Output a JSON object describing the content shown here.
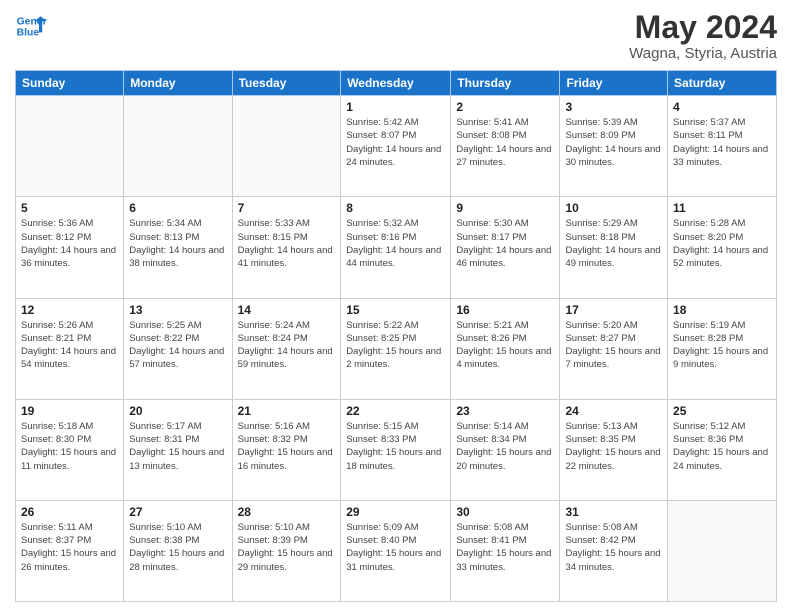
{
  "logo": {
    "line1": "General",
    "line2": "Blue"
  },
  "title": "May 2024",
  "subtitle": "Wagna, Styria, Austria",
  "days_of_week": [
    "Sunday",
    "Monday",
    "Tuesday",
    "Wednesday",
    "Thursday",
    "Friday",
    "Saturday"
  ],
  "weeks": [
    [
      {
        "day": "",
        "info": ""
      },
      {
        "day": "",
        "info": ""
      },
      {
        "day": "",
        "info": ""
      },
      {
        "day": "1",
        "info": "Sunrise: 5:42 AM\nSunset: 8:07 PM\nDaylight: 14 hours and 24 minutes."
      },
      {
        "day": "2",
        "info": "Sunrise: 5:41 AM\nSunset: 8:08 PM\nDaylight: 14 hours and 27 minutes."
      },
      {
        "day": "3",
        "info": "Sunrise: 5:39 AM\nSunset: 8:09 PM\nDaylight: 14 hours and 30 minutes."
      },
      {
        "day": "4",
        "info": "Sunrise: 5:37 AM\nSunset: 8:11 PM\nDaylight: 14 hours and 33 minutes."
      }
    ],
    [
      {
        "day": "5",
        "info": "Sunrise: 5:36 AM\nSunset: 8:12 PM\nDaylight: 14 hours and 36 minutes."
      },
      {
        "day": "6",
        "info": "Sunrise: 5:34 AM\nSunset: 8:13 PM\nDaylight: 14 hours and 38 minutes."
      },
      {
        "day": "7",
        "info": "Sunrise: 5:33 AM\nSunset: 8:15 PM\nDaylight: 14 hours and 41 minutes."
      },
      {
        "day": "8",
        "info": "Sunrise: 5:32 AM\nSunset: 8:16 PM\nDaylight: 14 hours and 44 minutes."
      },
      {
        "day": "9",
        "info": "Sunrise: 5:30 AM\nSunset: 8:17 PM\nDaylight: 14 hours and 46 minutes."
      },
      {
        "day": "10",
        "info": "Sunrise: 5:29 AM\nSunset: 8:18 PM\nDaylight: 14 hours and 49 minutes."
      },
      {
        "day": "11",
        "info": "Sunrise: 5:28 AM\nSunset: 8:20 PM\nDaylight: 14 hours and 52 minutes."
      }
    ],
    [
      {
        "day": "12",
        "info": "Sunrise: 5:26 AM\nSunset: 8:21 PM\nDaylight: 14 hours and 54 minutes."
      },
      {
        "day": "13",
        "info": "Sunrise: 5:25 AM\nSunset: 8:22 PM\nDaylight: 14 hours and 57 minutes."
      },
      {
        "day": "14",
        "info": "Sunrise: 5:24 AM\nSunset: 8:24 PM\nDaylight: 14 hours and 59 minutes."
      },
      {
        "day": "15",
        "info": "Sunrise: 5:22 AM\nSunset: 8:25 PM\nDaylight: 15 hours and 2 minutes."
      },
      {
        "day": "16",
        "info": "Sunrise: 5:21 AM\nSunset: 8:26 PM\nDaylight: 15 hours and 4 minutes."
      },
      {
        "day": "17",
        "info": "Sunrise: 5:20 AM\nSunset: 8:27 PM\nDaylight: 15 hours and 7 minutes."
      },
      {
        "day": "18",
        "info": "Sunrise: 5:19 AM\nSunset: 8:28 PM\nDaylight: 15 hours and 9 minutes."
      }
    ],
    [
      {
        "day": "19",
        "info": "Sunrise: 5:18 AM\nSunset: 8:30 PM\nDaylight: 15 hours and 11 minutes."
      },
      {
        "day": "20",
        "info": "Sunrise: 5:17 AM\nSunset: 8:31 PM\nDaylight: 15 hours and 13 minutes."
      },
      {
        "day": "21",
        "info": "Sunrise: 5:16 AM\nSunset: 8:32 PM\nDaylight: 15 hours and 16 minutes."
      },
      {
        "day": "22",
        "info": "Sunrise: 5:15 AM\nSunset: 8:33 PM\nDaylight: 15 hours and 18 minutes."
      },
      {
        "day": "23",
        "info": "Sunrise: 5:14 AM\nSunset: 8:34 PM\nDaylight: 15 hours and 20 minutes."
      },
      {
        "day": "24",
        "info": "Sunrise: 5:13 AM\nSunset: 8:35 PM\nDaylight: 15 hours and 22 minutes."
      },
      {
        "day": "25",
        "info": "Sunrise: 5:12 AM\nSunset: 8:36 PM\nDaylight: 15 hours and 24 minutes."
      }
    ],
    [
      {
        "day": "26",
        "info": "Sunrise: 5:11 AM\nSunset: 8:37 PM\nDaylight: 15 hours and 26 minutes."
      },
      {
        "day": "27",
        "info": "Sunrise: 5:10 AM\nSunset: 8:38 PM\nDaylight: 15 hours and 28 minutes."
      },
      {
        "day": "28",
        "info": "Sunrise: 5:10 AM\nSunset: 8:39 PM\nDaylight: 15 hours and 29 minutes."
      },
      {
        "day": "29",
        "info": "Sunrise: 5:09 AM\nSunset: 8:40 PM\nDaylight: 15 hours and 31 minutes."
      },
      {
        "day": "30",
        "info": "Sunrise: 5:08 AM\nSunset: 8:41 PM\nDaylight: 15 hours and 33 minutes."
      },
      {
        "day": "31",
        "info": "Sunrise: 5:08 AM\nSunset: 8:42 PM\nDaylight: 15 hours and 34 minutes."
      },
      {
        "day": "",
        "info": ""
      }
    ]
  ]
}
